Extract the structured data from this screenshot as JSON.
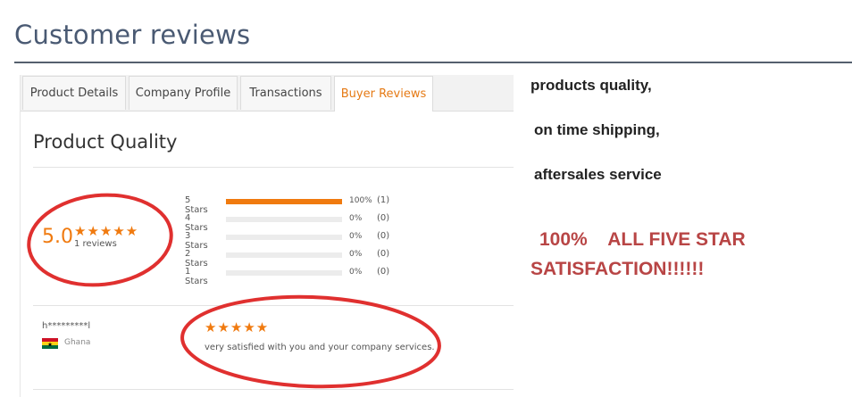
{
  "page": {
    "title": "Customer reviews"
  },
  "tabs": [
    {
      "label": "Product Details",
      "active": false
    },
    {
      "label": "Company Profile",
      "active": false
    },
    {
      "label": "Transactions",
      "active": false
    },
    {
      "label": "Buyer Reviews",
      "active": true
    }
  ],
  "product_quality": {
    "title": "Product Quality",
    "score": "5.0",
    "stars": "★★★★★",
    "review_count": "1 reviews",
    "breakdown": [
      {
        "label": "5 Stars",
        "fraction": 1.0,
        "percent": "100%",
        "count": "(1)"
      },
      {
        "label": "4 Stars",
        "fraction": 0.0,
        "percent": "0%",
        "count": "(0)"
      },
      {
        "label": "3 Stars",
        "fraction": 0.0,
        "percent": "0%",
        "count": "(0)"
      },
      {
        "label": "2 Stars",
        "fraction": 0.0,
        "percent": "0%",
        "count": "(0)"
      },
      {
        "label": "1 Stars",
        "fraction": 0.0,
        "percent": "0%",
        "count": "(0)"
      }
    ]
  },
  "review": {
    "reviewer": "h*********l",
    "country": "Ghana",
    "stars": "★★★★★",
    "text": "very satisfied with you and your company services."
  },
  "side_notes": {
    "line1": "products quality,",
    "line2": "on time shipping,",
    "line3": "aftersales service",
    "promo_line1": "100%    ALL FIVE STAR",
    "promo_line2": "SATISFACTION!!!!!!"
  },
  "colors": {
    "accent": "#f07a0f",
    "heading": "#4a5a73",
    "annotation": "#e0302f",
    "promo": "#b84545"
  }
}
